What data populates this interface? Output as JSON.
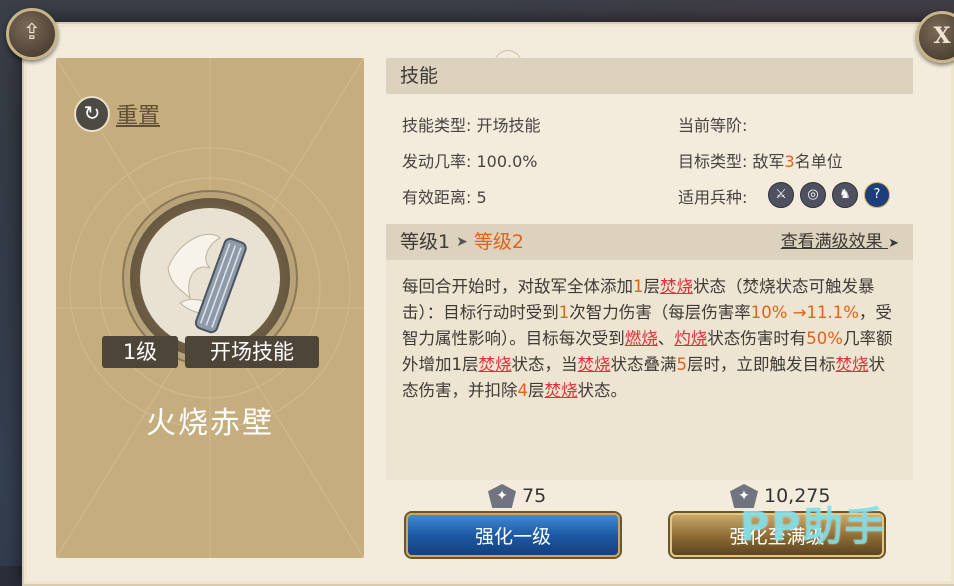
{
  "header": {
    "share_icon": "share-icon",
    "close_label": "X"
  },
  "left": {
    "reset_label": "重置",
    "reset_icon": "refresh-icon",
    "level_badge": "1级",
    "type_badge": "开场技能",
    "skill_name": "火烧赤壁"
  },
  "skill_section": {
    "title": "技能",
    "type_key": "技能类型:",
    "type_value": "开场技能",
    "rate_key": "发动几率:",
    "rate_value": "100.0%",
    "range_key": "有效距离:",
    "range_value": "5",
    "tier_key": "当前等阶:",
    "tier_value": "",
    "target_key": "目标类型:",
    "target_prefix": "敌军",
    "target_count": "3",
    "target_suffix": "名单位",
    "troops_key": "适用兵种:",
    "troop_icons": [
      "sword-icon",
      "target-icon",
      "horse-icon",
      "question-icon"
    ]
  },
  "level_section": {
    "from": "等级1",
    "to": "等级2",
    "view_max": "查看满级效果"
  },
  "description": {
    "t1": "每回合开始时，对敌军全体添加",
    "n1": "1",
    "t2": "层",
    "s1": "焚烧",
    "t3": "状态（焚烧状态可触发暴击）：目标行动时受到",
    "n2": "1",
    "t4": "次智力伤害（每层伤害率",
    "pct": "10% →11.1%",
    "t5": "，受智力属性影响）。目标每次受到",
    "s2": "燃烧",
    "t6": "、",
    "s3": "灼烧",
    "t7": "状态伤害时有",
    "n3": "50%",
    "t8": "几率额外增加",
    "n4": "1",
    "t9": "层",
    "s4": "焚烧",
    "t10": "状态，当",
    "s5": "焚烧",
    "t11": "状态叠满",
    "n5": "5",
    "t12": "层时，立即触发目标",
    "s6": "焚烧",
    "t13": "状态伤害，并扣除",
    "n6": "4",
    "t14": "层",
    "s7": "焚烧",
    "t15": "状态。"
  },
  "costs": {
    "upgrade_one": "75",
    "upgrade_max": "10,275"
  },
  "buttons": {
    "upgrade_one": "强化一级",
    "upgrade_max": "强化至满级"
  },
  "watermark": "PP助手",
  "colors": {
    "highlight_orange": "#e0631a",
    "highlight_red": "#e0313a",
    "card_bg": "#c6ad7d"
  }
}
